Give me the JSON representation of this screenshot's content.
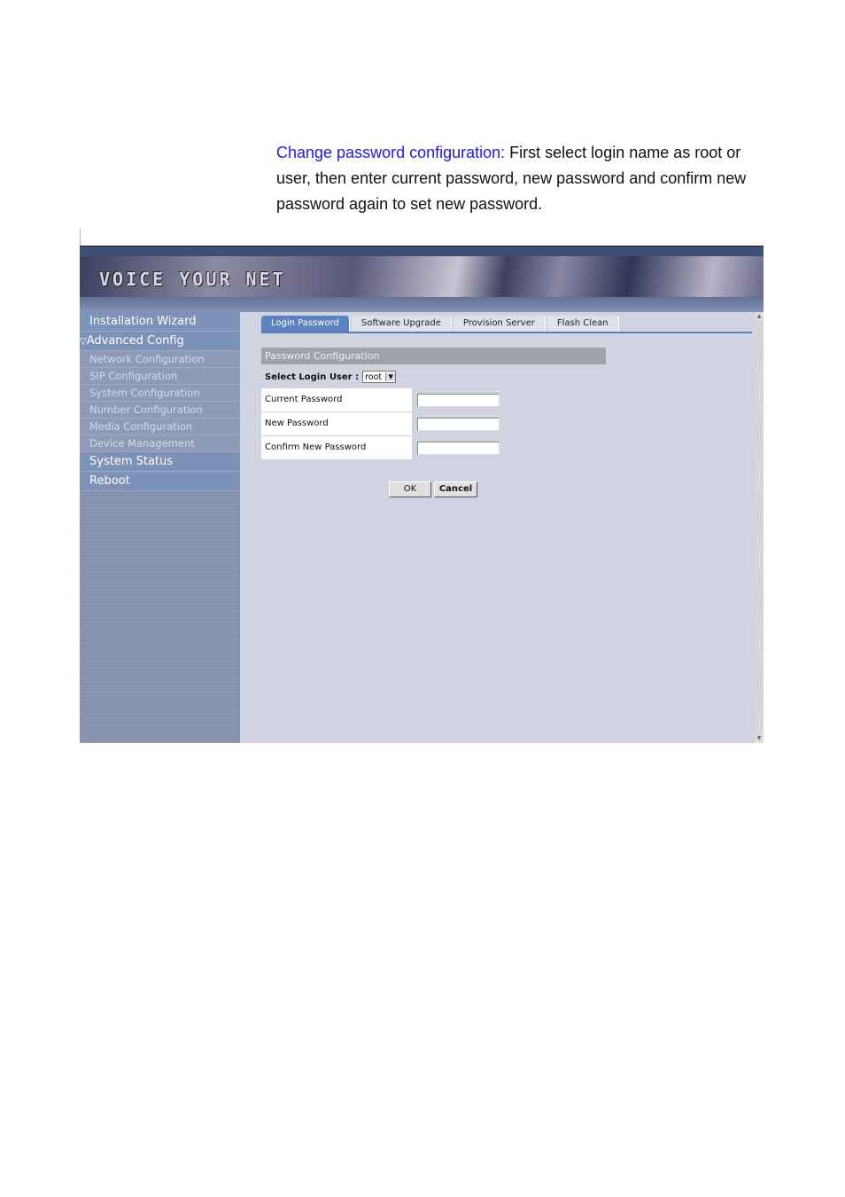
{
  "intro": {
    "highlight": "Change password configuration:",
    "text": " First select login name as root or user, then enter current password, new password and confirm new password again to set new password."
  },
  "banner": {
    "logo": "VOICE YOUR NET"
  },
  "sidebar": {
    "items": [
      {
        "label": "Installation Wizard"
      },
      {
        "label": "Advanced Config",
        "expanded": true
      },
      {
        "label": "Network Configuration"
      },
      {
        "label": "SIP Configuration"
      },
      {
        "label": "System Configuration"
      },
      {
        "label": "Number Configuration"
      },
      {
        "label": "Media Configuration"
      },
      {
        "label": "Device Management"
      },
      {
        "label": "System Status"
      },
      {
        "label": "Reboot"
      }
    ]
  },
  "tabs": [
    {
      "label": "Login Password",
      "active": true
    },
    {
      "label": "Software Upgrade"
    },
    {
      "label": "Provision Server"
    },
    {
      "label": "Flash Clean"
    }
  ],
  "form": {
    "section_title": "Password Configuration",
    "select_label": "Select Login User :",
    "select_value": "root",
    "fields": [
      {
        "label": "Current Password",
        "value": ""
      },
      {
        "label": "New Password",
        "value": ""
      },
      {
        "label": "Confirm New Password",
        "value": ""
      }
    ],
    "ok": "OK",
    "cancel": "Cancel"
  },
  "colors": {
    "link": "#1a1aff",
    "active_tab": "#5b83c0",
    "sidebar": "#7d92b8",
    "content_bg": "#cfd4e0"
  }
}
